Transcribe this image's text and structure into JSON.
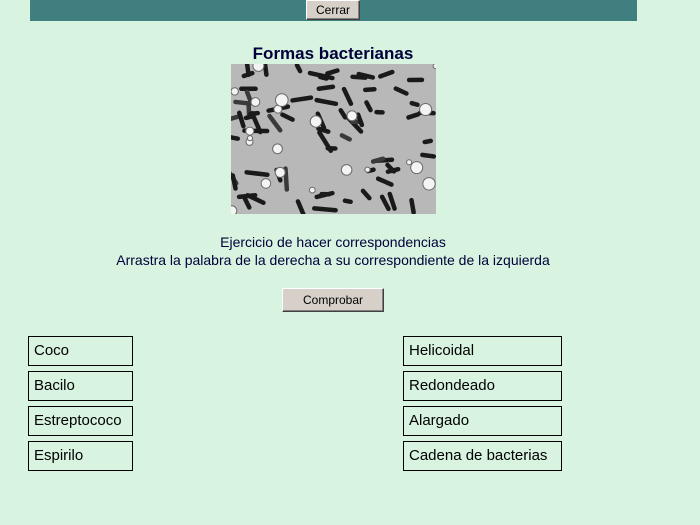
{
  "header": {
    "close_label": "Cerrar"
  },
  "exercise": {
    "title": "Formas bacterianas",
    "instruction_line1": "Ejercicio de hacer correspondencias",
    "instruction_line2": "Arrastra la palabra de la derecha a su correspondiente de la izquierda",
    "check_label": "Comprobar"
  },
  "left_terms": [
    "Coco",
    "Bacilo",
    "Estreptococo",
    "Espirilo"
  ],
  "right_definitions": [
    "Helicoidal",
    "Redondeado",
    "Alargado",
    "Cadena de bacterias"
  ],
  "colors": {
    "background": "#d8f3df",
    "topbar": "#3f7f7f",
    "title": "#00003a"
  }
}
